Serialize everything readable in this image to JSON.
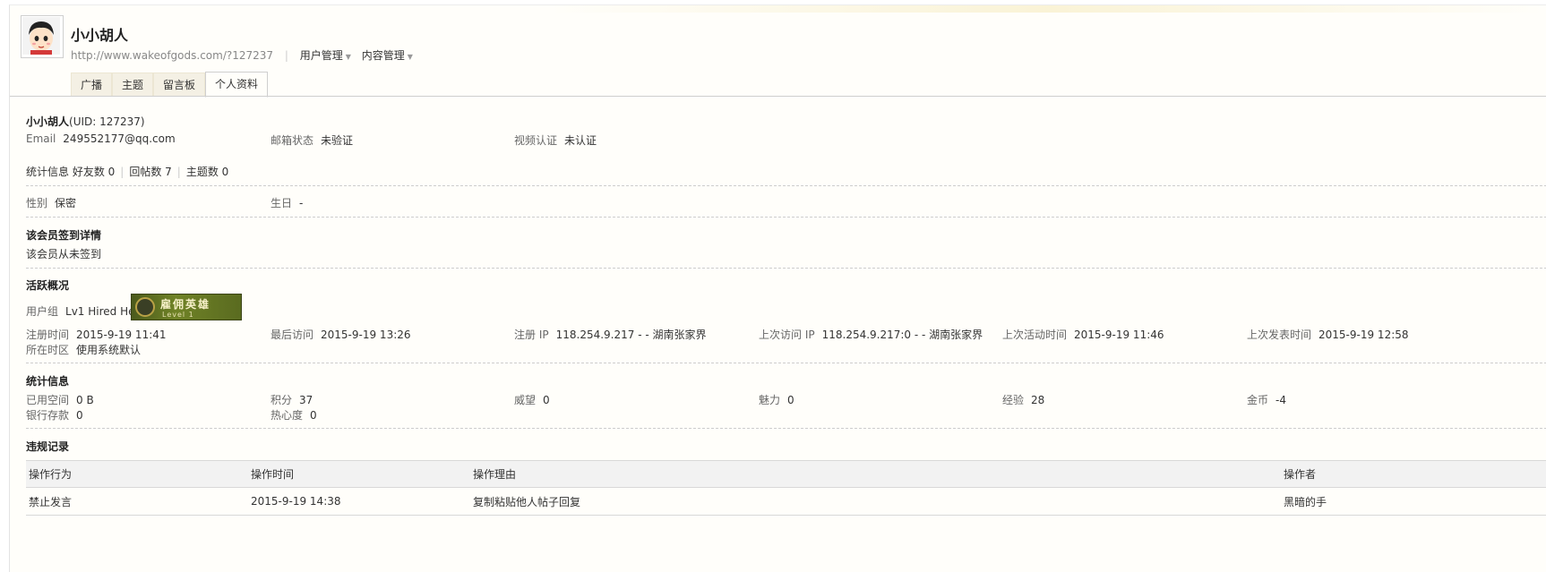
{
  "profile": {
    "name": "小小胡人",
    "url": "http://www.wakeofgods.com/?127237",
    "menus": [
      "用户管理",
      "内容管理"
    ]
  },
  "tabs": [
    "广播",
    "主题",
    "留言板",
    "个人资料"
  ],
  "active_tab": "个人资料",
  "info": {
    "name_uid": "小小胡人",
    "uid_text": "(UID: 127237)",
    "email_label": "Email",
    "email": "249552177@qq.com",
    "mail_status_label": "邮箱状态",
    "mail_status": "未验证",
    "video_label": "视频认证",
    "video": "未认证",
    "stats_label": "统计信息",
    "friends": "好友数 0",
    "replies": "回帖数 7",
    "topics": "主题数 0",
    "gender_label": "性别",
    "gender": "保密",
    "birthday_label": "生日",
    "birthday": "-"
  },
  "signin": {
    "title": "该会员签到详情",
    "text": "该会员从未签到"
  },
  "activity": {
    "title": "活跃概况",
    "group_label": "用户组",
    "group": "Lv1 Hired Hero",
    "badge_main": "雇佣英雄",
    "badge_sub": "Level 1",
    "reg_time_label": "注册时间",
    "reg_time": "2015-9-19 11:41",
    "last_visit_label": "最后访问",
    "last_visit": "2015-9-19 13:26",
    "reg_ip_label": "注册 IP",
    "reg_ip": "118.254.9.217 - - 湖南张家界",
    "last_ip_label": "上次访问 IP",
    "last_ip": "118.254.9.217:0 - - 湖南张家界",
    "last_active_label": "上次活动时间",
    "last_active": "2015-9-19 11:46",
    "last_post_label": "上次发表时间",
    "last_post": "2015-9-19 12:58",
    "tz_label": "所在时区",
    "tz": "使用系统默认"
  },
  "stats": {
    "title": "统计信息",
    "space_label": "已用空间",
    "space": "0 B",
    "points_label": "积分",
    "points": "37",
    "prestige_label": "威望",
    "prestige": "0",
    "charm_label": "魅力",
    "charm": "0",
    "exp_label": "经验",
    "exp": "28",
    "gold_label": "金币",
    "gold": "-4",
    "bank_label": "银行存款",
    "bank": "0",
    "zeal_label": "热心度",
    "zeal": "0"
  },
  "violations": {
    "title": "违规记录",
    "headers": [
      "操作行为",
      "操作时间",
      "操作理由",
      "操作者"
    ],
    "rows": [
      [
        "禁止发言",
        "2015-9-19 14:38",
        "复制粘贴他人帖子回复",
        "黑暗的手"
      ]
    ]
  },
  "colors": {
    "page_bg": "#fffefa",
    "tab_bg": "#f4f0e4",
    "border": "#cfcfcf",
    "table_head": "#f2f2f2"
  }
}
